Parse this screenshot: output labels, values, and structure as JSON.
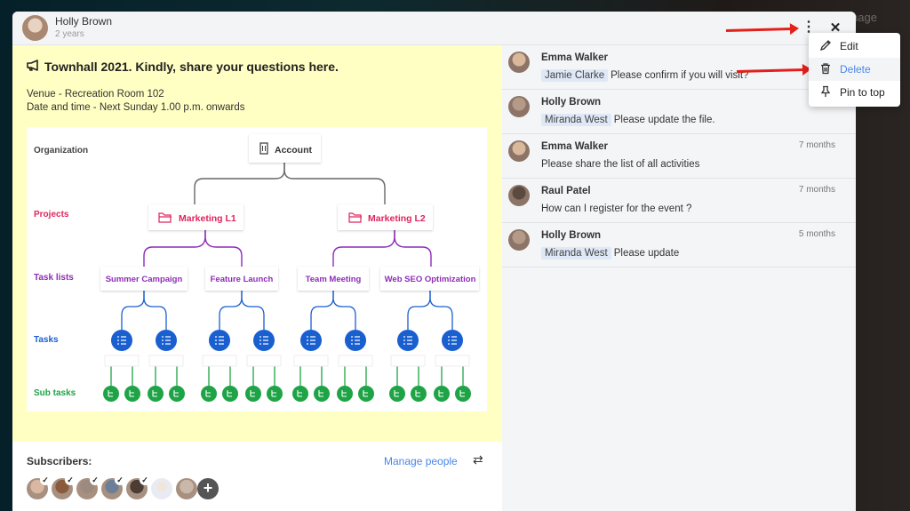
{
  "background": {
    "partial_text": "nage"
  },
  "header": {
    "author": "Holly Brown",
    "time": "2 years",
    "more_icon": "kebab-vertical-icon",
    "close_icon": "close-icon"
  },
  "post": {
    "title": "Townhall 2021. Kindly, share your questions here.",
    "title_icon": "megaphone-icon",
    "lines": [
      "Venue - Recreation Room 102",
      "Date and time - Next Sunday 1.00 p.m. onwards"
    ]
  },
  "diagram": {
    "row_labels": {
      "organization": "Organization",
      "projects": "Projects",
      "task_lists": "Task lists",
      "tasks": "Tasks",
      "sub_tasks": "Sub tasks"
    },
    "colors": {
      "organization": "#444444",
      "projects": "#e0245e",
      "task_lists": "#8e2cb8",
      "tasks": "#1a5fd0",
      "sub_tasks": "#1ea446"
    },
    "account": "Account",
    "projects": [
      "Marketing L1",
      "Marketing L2"
    ],
    "task_lists": [
      "Summer Campaign",
      "Feature Launch",
      "Team Meeting",
      "Web SEO Optimization"
    ]
  },
  "subscribers": {
    "label": "Subscribers:",
    "manage_label": "Manage people",
    "swap_icon": "swap-arrows-icon",
    "avatars": [
      {
        "checked": true,
        "color": "#d8b8a0"
      },
      {
        "checked": true,
        "color": "#8a5a3c"
      },
      {
        "checked": true,
        "color": "#9c8a80"
      },
      {
        "checked": true,
        "color": "#6c7f96"
      },
      {
        "checked": true,
        "color": "#4c3c34"
      },
      {
        "checked": false,
        "color": "#e6e8ec"
      },
      {
        "checked": false,
        "color": "#c9b8aa"
      }
    ],
    "add_icon": "plus-icon"
  },
  "comments": [
    {
      "name": "Emma Walker",
      "time": "",
      "mention": "Jamie Clarke",
      "text": "Please confirm if you will visit?",
      "avatar_color": "#d9b89c"
    },
    {
      "name": "Holly Brown",
      "time": "",
      "mention": "Miranda West",
      "text": "Please update the file.",
      "avatar_color": "#b59a88"
    },
    {
      "name": "Emma Walker",
      "time": "7 months",
      "mention": "",
      "text": "Please share the list of all activities",
      "avatar_color": "#d9b89c"
    },
    {
      "name": "Raul Patel",
      "time": "7 months",
      "mention": "",
      "text": "How can I register for the event ?",
      "avatar_color": "#5b4a40"
    },
    {
      "name": "Holly Brown",
      "time": "5 months",
      "mention": "Miranda West",
      "text": "Please update",
      "avatar_color": "#b59a88"
    }
  ],
  "menu": {
    "items": [
      {
        "label": "Edit",
        "icon": "pencil-icon"
      },
      {
        "label": "Delete",
        "icon": "trash-icon",
        "highlighted": true
      },
      {
        "label": "Pin to top",
        "icon": "pin-icon"
      }
    ]
  }
}
